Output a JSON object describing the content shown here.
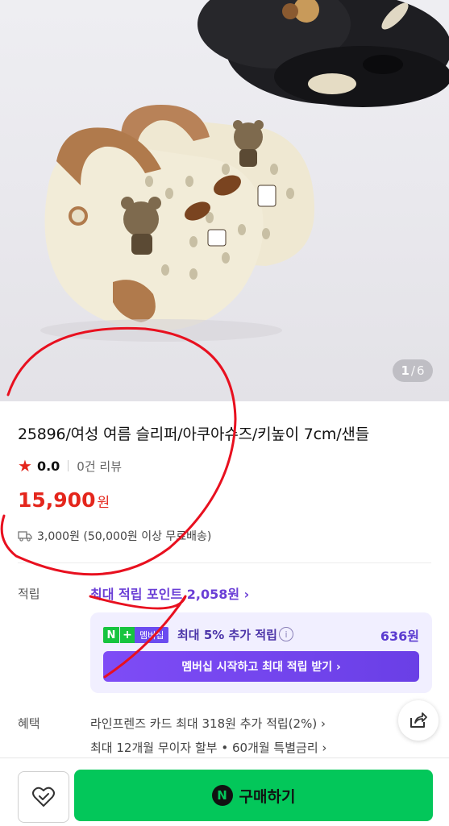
{
  "gallery": {
    "current": "1",
    "separator": "/",
    "total": "6"
  },
  "product": {
    "title": "25896/여성 여름 슬리퍼/아쿠아슈즈/키높이 7cm/샌들",
    "rating_score": "0.0",
    "review_count": "0건 리뷰",
    "price": "15,900",
    "price_unit": "원",
    "shipping": "3,000원 (50,000원 이상 무료배송)"
  },
  "points": {
    "label": "적립",
    "max_link": "최대 적립 포인트 2,058원 ›",
    "badge_n": "N",
    "badge_plus": "+",
    "badge_tag": "멤버십",
    "membership_text": "최대 5% 추가 적립",
    "membership_points": "636원",
    "membership_button": "멤버십 시작하고 최대 적립 받기 ›"
  },
  "benefits": {
    "label": "혜택",
    "line1": "라인프렌즈 카드 최대 318원 추가 적립(2%) ›",
    "line2": "최대 12개월 무이자 할부 • 60개월 특별금리 ›"
  },
  "bottom_bar": {
    "buy_label": "구매하기",
    "npay_glyph": "N"
  },
  "colors": {
    "price_red": "#e4261c",
    "accent_purple": "#6b3fd6",
    "buy_green": "#03c75a",
    "annotation_red": "#e8101f"
  }
}
